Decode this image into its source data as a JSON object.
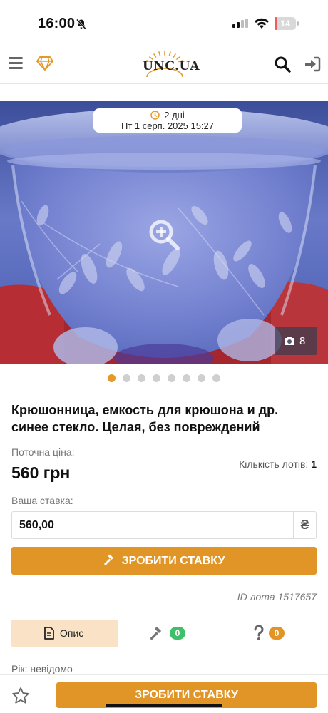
{
  "status_bar": {
    "time": "16:00",
    "battery": "14",
    "battery_level": 0.14
  },
  "header": {
    "logo_text": "UNC.UA"
  },
  "image": {
    "timer_days": "2 дні",
    "timer_date": "Пт 1 серп. 2025 15:27",
    "photo_count": "8",
    "dots_total": 8,
    "dots_active": 0
  },
  "lot": {
    "title": "Крюшонница, емкость для крюшона и др. синее стекло. Целая, без повреждений",
    "price_label": "Поточна ціна:",
    "price_value": "560 грн",
    "lots_count_label": "Кількість лотів:",
    "lots_count_value": "1",
    "bid_label": "Ваша ставка:",
    "bid_value": "560,00",
    "currency": "₴",
    "bid_button": "ЗРОБИТИ СТАВКУ",
    "lot_id": "ID лота 1517657"
  },
  "tabs": {
    "description": "Опис",
    "bids_count": "0",
    "questions_count": "0"
  },
  "details": {
    "year": "Рік: невідомо"
  },
  "bottom": {
    "bid_button": "ЗРОБИТИ СТАВКУ"
  },
  "colors": {
    "accent": "#e09526",
    "tab_active_bg": "#f9e2c6",
    "badge_green": "#3fbf6a"
  }
}
